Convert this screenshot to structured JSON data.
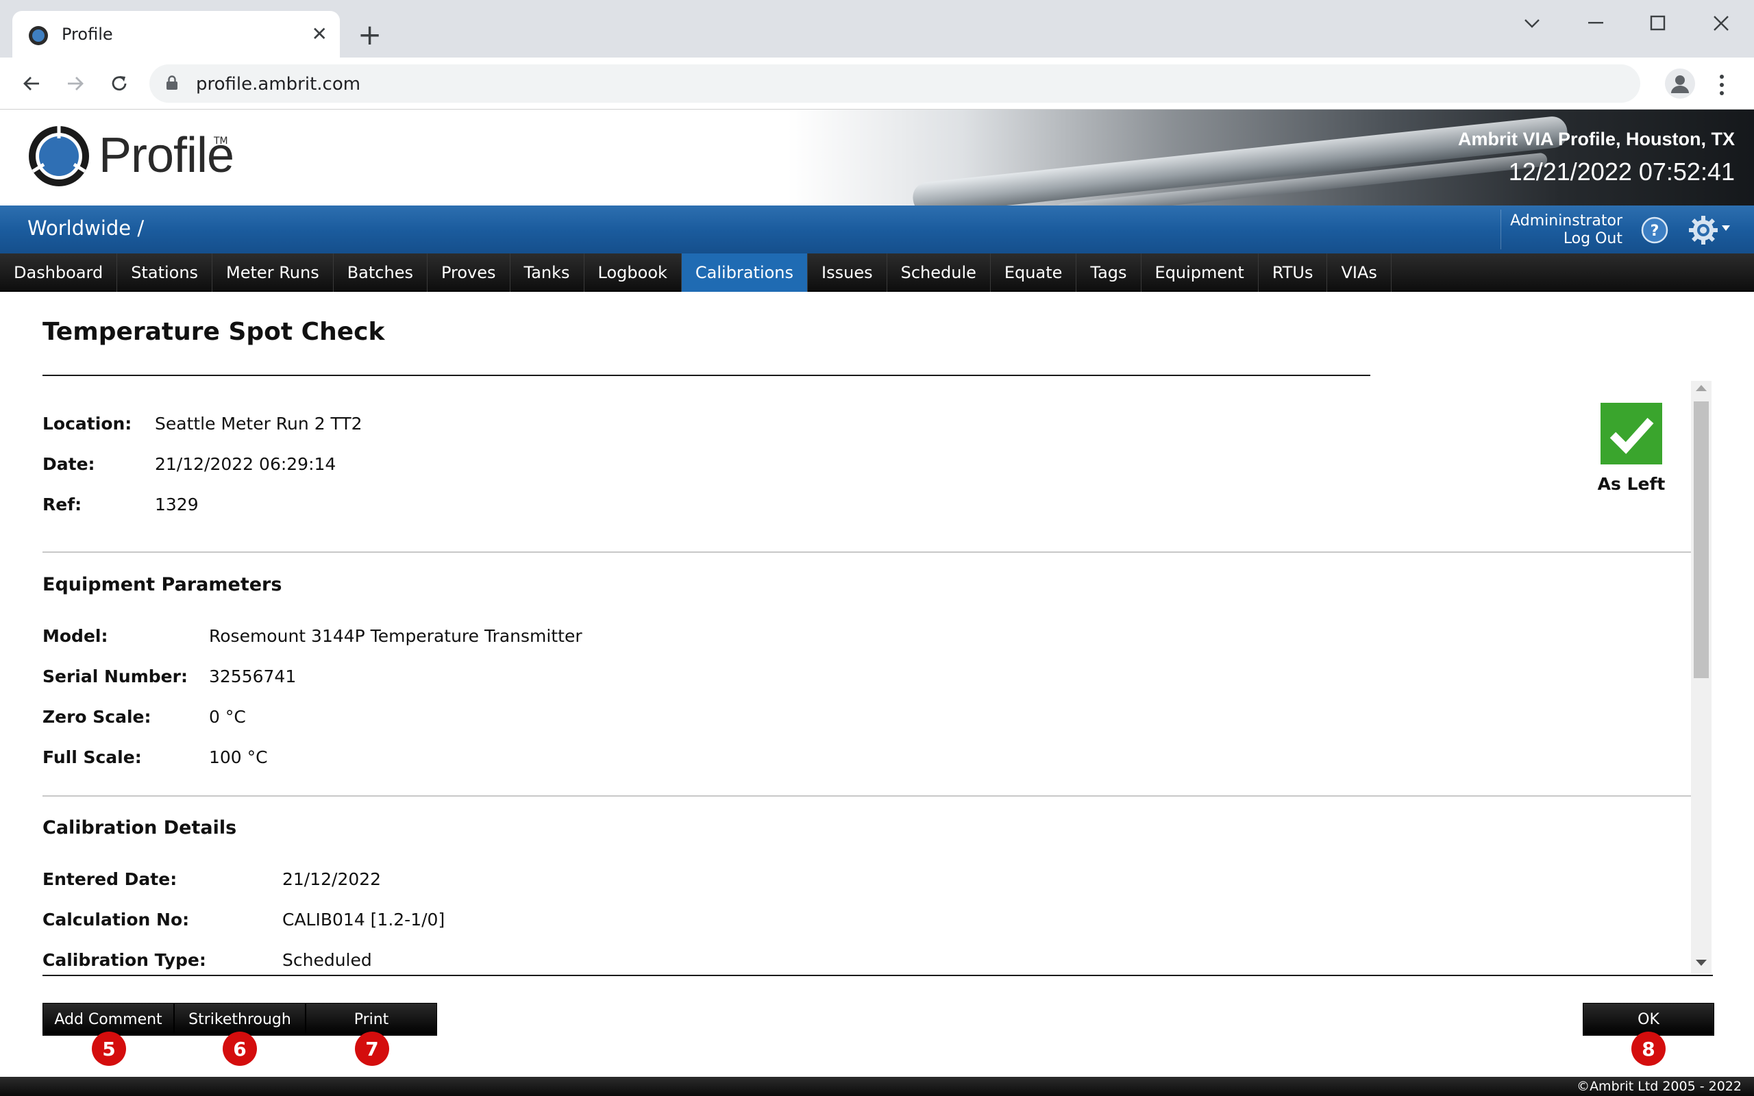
{
  "browser": {
    "tab_title": "Profile",
    "url": "profile.ambrit.com"
  },
  "header": {
    "logo_text": "Profile",
    "logo_tm": "TM",
    "site_name": "Ambrit VIA Profile, Houston, TX",
    "datetime": "12/21/2022 07:52:41"
  },
  "bluebar": {
    "breadcrumb": "Worldwide /",
    "user": "Admininstrator",
    "logout": "Log Out"
  },
  "nav": {
    "items": [
      "Dashboard",
      "Stations",
      "Meter Runs",
      "Batches",
      "Proves",
      "Tanks",
      "Logbook",
      "Calibrations",
      "Issues",
      "Schedule",
      "Equate",
      "Tags",
      "Equipment",
      "RTUs",
      "VIAs"
    ],
    "active": "Calibrations"
  },
  "page": {
    "title": "Temperature Spot Check",
    "status_label": "As Left",
    "summary": {
      "location_label": "Location:",
      "location": "Seattle Meter Run 2 TT2",
      "date_label": "Date:",
      "date": "21/12/2022 06:29:14",
      "ref_label": "Ref:",
      "ref": "1329"
    },
    "equipment": {
      "title": "Equipment Parameters",
      "model_label": "Model:",
      "model": "Rosemount 3144P Temperature Transmitter",
      "serial_label": "Serial Number:",
      "serial": "32556741",
      "zero_label": "Zero Scale:",
      "zero": "0 °C",
      "full_label": "Full Scale:",
      "full": "100 °C"
    },
    "calibration": {
      "title": "Calibration Details",
      "entered_label": "Entered Date:",
      "entered": "21/12/2022",
      "calcno_label": "Calculation No:",
      "calcno": "CALIB014 [1.2-1/0]",
      "type_label": "Calibration Type:",
      "type": "Scheduled"
    }
  },
  "actions": {
    "add_comment": "Add Comment",
    "strikethrough": "Strikethrough",
    "print": "Print",
    "ok": "OK",
    "badges": [
      "5",
      "6",
      "7",
      "8"
    ]
  },
  "footer": {
    "copyright": "©Ambrit Ltd 2005 - 2022"
  },
  "colors": {
    "accent_blue": "#1f6bb3",
    "status_green": "#3aa52d",
    "badge_red": "#d40d0d"
  }
}
